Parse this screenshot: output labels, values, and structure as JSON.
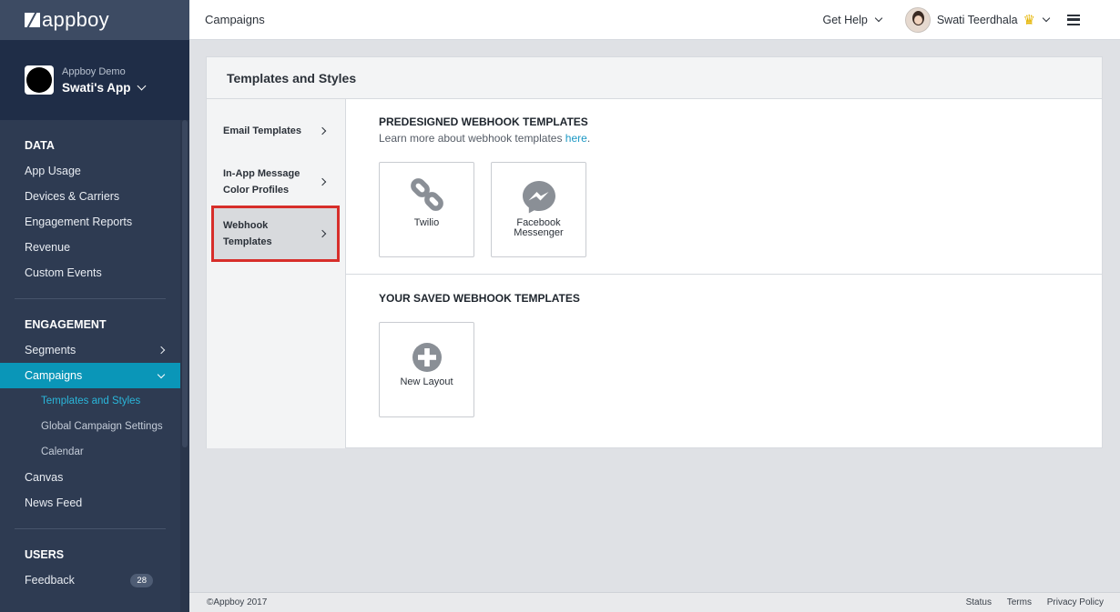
{
  "brand": {
    "logo_text": "appboy"
  },
  "app": {
    "org": "Appboy Demo",
    "name": "Swati's App"
  },
  "sidebar": {
    "sections": [
      {
        "heading": "DATA",
        "items": [
          "App Usage",
          "Devices & Carriers",
          "Engagement Reports",
          "Revenue",
          "Custom Events"
        ]
      },
      {
        "heading": "ENGAGEMENT",
        "items": [
          "Segments",
          "Campaigns",
          "Templates and Styles",
          "Global Campaign Settings",
          "Calendar",
          "Canvas",
          "News Feed"
        ]
      },
      {
        "heading": "USERS",
        "items": [
          "Feedback"
        ]
      }
    ],
    "feedback_count": "28"
  },
  "header": {
    "title": "Campaigns",
    "help": "Get Help",
    "user_name": "Swati Teerdhala"
  },
  "panel": {
    "title": "Templates and Styles",
    "nav": [
      {
        "line1": "Email Templates",
        "line2": ""
      },
      {
        "line1": "In-App Message",
        "line2": "Color Profiles"
      },
      {
        "line1": "Webhook",
        "line2": "Templates"
      }
    ],
    "predesigned_title": "PREDESIGNED WEBHOOK TEMPLATES",
    "predesigned_desc": "Learn more about webhook templates ",
    "predesigned_link": "here",
    "predesigned_period": ".",
    "cards": [
      {
        "line1": "Twilio",
        "line2": ""
      },
      {
        "line1": "Facebook",
        "line2": "Messenger"
      }
    ],
    "saved_title": "YOUR SAVED WEBHOOK TEMPLATES",
    "new_layout": "New Layout"
  },
  "footer": {
    "copyright": "©Appboy 2017",
    "links": [
      "Status",
      "Terms",
      "Privacy Policy"
    ]
  },
  "colors": {
    "sidebar_bg": "#2e3b52",
    "active_nav": "#0a96b8",
    "active_sub": "#2ab6da",
    "highlight_border": "#d72e2a",
    "link": "#1c98c4"
  }
}
